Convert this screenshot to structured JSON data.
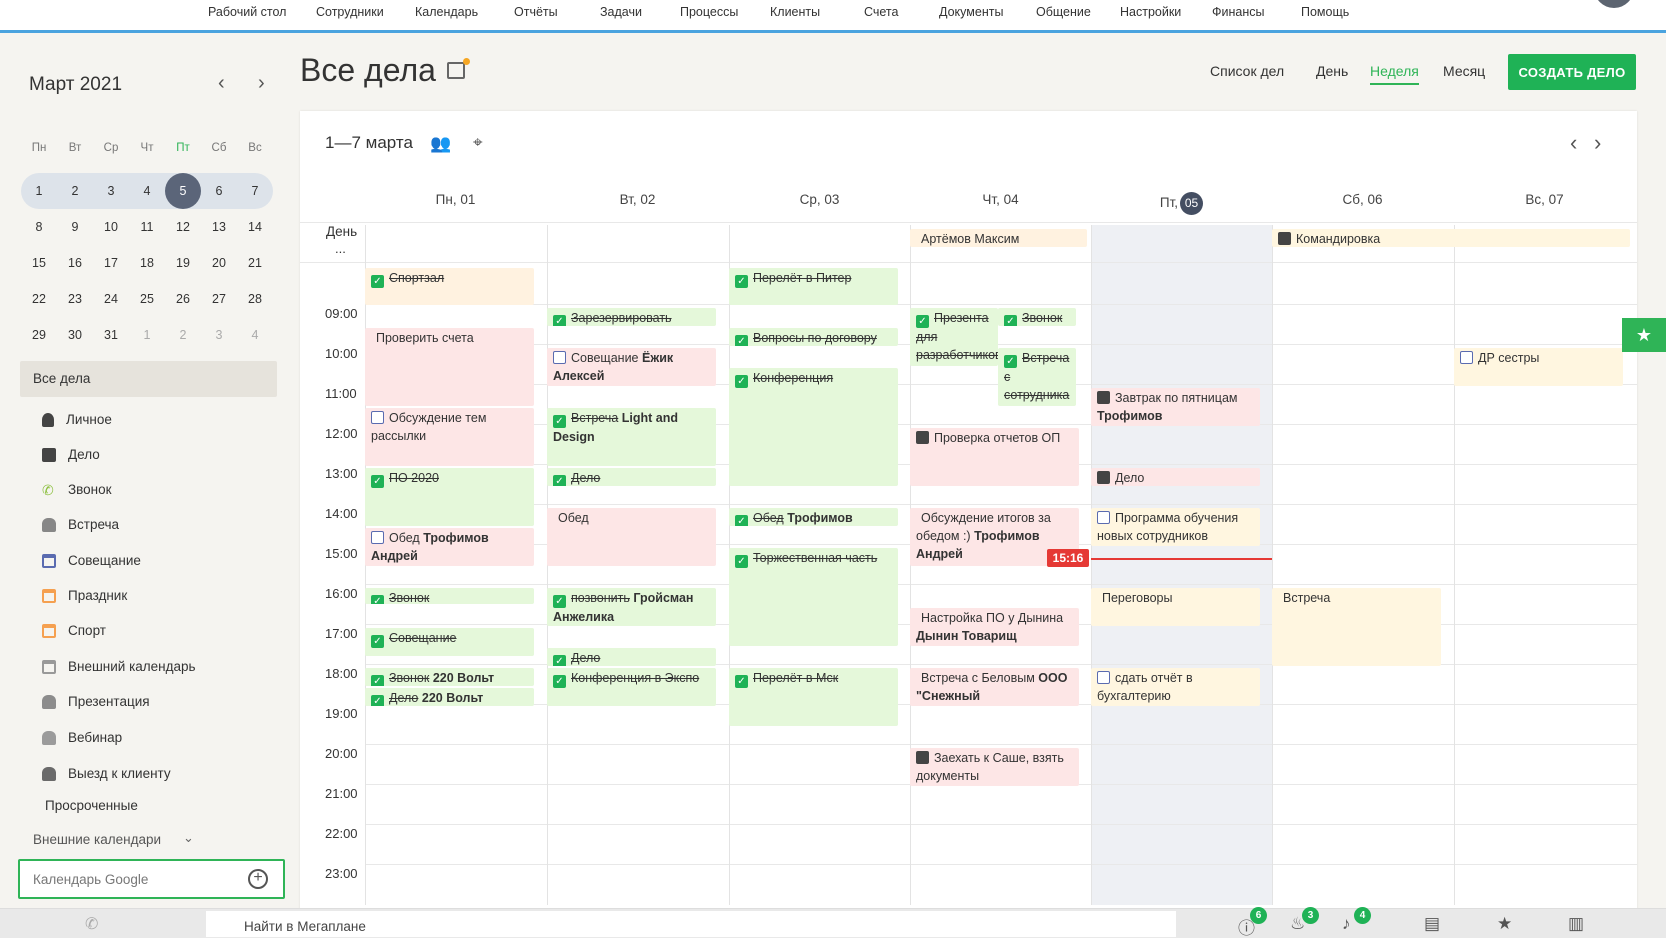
{
  "topnav": {
    "items": [
      "Рабочий стол",
      "Сотрудники",
      "Календарь",
      "Отчёты",
      "Задачи",
      "Процессы",
      "Клиенты",
      "Счета",
      "Документы",
      "Общение",
      "Настройки",
      "Финансы",
      "Помощь"
    ]
  },
  "minical": {
    "title": "Март 2021",
    "prev": "‹",
    "next": "›",
    "weekdays": [
      "Пн",
      "Вт",
      "Ср",
      "Чт",
      "Пт",
      "Сб",
      "Вс"
    ],
    "weeks": [
      [
        "1",
        "2",
        "3",
        "4",
        "5",
        "6",
        "7"
      ],
      [
        "8",
        "9",
        "10",
        "11",
        "12",
        "13",
        "14"
      ],
      [
        "15",
        "16",
        "17",
        "18",
        "19",
        "20",
        "21"
      ],
      [
        "22",
        "23",
        "24",
        "25",
        "26",
        "27",
        "28"
      ],
      [
        "29",
        "30",
        "31",
        "1",
        "2",
        "3",
        "4"
      ]
    ],
    "today": "5"
  },
  "sidebar": {
    "all": "Все дела",
    "categories": [
      {
        "label": "Личное",
        "icon": "person-icon",
        "color": "#444444"
      },
      {
        "label": "Дело",
        "icon": "briefcase-icon",
        "color": "#444444"
      },
      {
        "label": "Звонок",
        "icon": "phone-icon",
        "color": "#8cbf3f"
      },
      {
        "label": "Встреча",
        "icon": "people-icon",
        "color": "#e06c8a"
      },
      {
        "label": "Совещание",
        "icon": "calendar-icon",
        "color": "#5a6bb0"
      },
      {
        "label": "Праздник",
        "icon": "calendar-icon",
        "color": "#f5a050"
      },
      {
        "label": "Спорт",
        "icon": "calendar-icon",
        "color": "#f5a050"
      },
      {
        "label": "Внешний календарь",
        "icon": "calendar-icon",
        "color": "#999999"
      },
      {
        "label": "Презентация",
        "icon": "people-icon",
        "color": "#3caa4a"
      },
      {
        "label": "Вебинар",
        "icon": "people-icon",
        "color": "#f5884a"
      },
      {
        "label": "Выезд к клиенту",
        "icon": "people-icon",
        "color": "#8a5aa8"
      }
    ],
    "overdue": "Просроченные",
    "external": "Внешние календари",
    "google": "Календарь Google"
  },
  "header": {
    "title": "Все дела",
    "views": [
      "Список дел",
      "День",
      "Неделя",
      "Месяц"
    ],
    "active_view": "Неделя",
    "create": "СОЗДАТЬ ДЕЛО"
  },
  "calendar": {
    "range": "1—7 марта",
    "days": [
      "Пн, 01",
      "Вт, 02",
      "Ср, 03",
      "Чт, 04",
      "Пт,",
      "Сб, 06",
      "Вс, 07"
    ],
    "today_badge": "05",
    "allday_label": "День",
    "allday_more": "...",
    "hours": [
      "09:00",
      "10:00",
      "11:00",
      "12:00",
      "13:00",
      "14:00",
      "15:00",
      "16:00",
      "17:00",
      "18:00",
      "19:00",
      "20:00",
      "21:00",
      "22:00",
      "23:00"
    ],
    "now": "15:16",
    "allday_events": [
      {
        "day": 3,
        "icon": "cake",
        "text": "Артёмов Максим",
        "span": 1
      },
      {
        "day": 5,
        "icon": "bag",
        "text": "Командировка",
        "span": 2
      }
    ],
    "events": [
      {
        "day": 0,
        "cls": "o",
        "icon": "check",
        "text": "Спортзал",
        "strike": true,
        "bold": ""
      },
      {
        "day": 0,
        "cls": "p",
        "icon": "people",
        "text": "Проверить счета",
        "strike": false,
        "bold": ""
      },
      {
        "day": 0,
        "cls": "p",
        "icon": "cal",
        "text": "Обсуждение тем рассылки",
        "strike": false,
        "bold": ""
      },
      {
        "day": 0,
        "cls": "g",
        "icon": "check",
        "text": "ПО 2020",
        "strike": true,
        "bold": ""
      },
      {
        "day": 0,
        "cls": "p",
        "icon": "cal",
        "text": "Обед",
        "strike": false,
        "bold": "Трофимов Андрей"
      },
      {
        "day": 0,
        "cls": "g",
        "icon": "check",
        "text": "Звонок",
        "strike": true,
        "bold": ""
      },
      {
        "day": 0,
        "cls": "g",
        "icon": "check",
        "text": "Совещание",
        "strike": true,
        "bold": ""
      },
      {
        "day": 0,
        "cls": "g",
        "icon": "check",
        "text": "Звонок",
        "strike": true,
        "bold": "220 Вольт"
      },
      {
        "day": 0,
        "cls": "g",
        "icon": "check",
        "text": "Дело",
        "strike": true,
        "bold": "220 Вольт"
      },
      {
        "day": 1,
        "cls": "g",
        "icon": "check",
        "text": "Зарезервировать",
        "strike": true,
        "bold": ""
      },
      {
        "day": 1,
        "cls": "p",
        "icon": "cal",
        "text": "Совещание",
        "strike": false,
        "bold": "Ёжик Алексей"
      },
      {
        "day": 1,
        "cls": "g",
        "icon": "check",
        "text": "Встреча",
        "strike": true,
        "bold": "Light and Design"
      },
      {
        "day": 1,
        "cls": "g",
        "icon": "check",
        "text": "Дело",
        "strike": true,
        "bold": ""
      },
      {
        "day": 1,
        "cls": "p",
        "icon": "people",
        "text": "Обед",
        "strike": false,
        "bold": ""
      },
      {
        "day": 1,
        "cls": "g",
        "icon": "check",
        "text": "позвонить",
        "strike": true,
        "bold": "Гройсман Анжелика"
      },
      {
        "day": 1,
        "cls": "g",
        "icon": "check",
        "text": "Дело",
        "strike": true,
        "bold": ""
      },
      {
        "day": 1,
        "cls": "g",
        "icon": "check",
        "text": "Конференция в Экспо",
        "strike": true,
        "bold": ""
      },
      {
        "day": 2,
        "cls": "g",
        "icon": "check",
        "text": "Перелёт в Питер",
        "strike": true,
        "bold": ""
      },
      {
        "day": 2,
        "cls": "g",
        "icon": "check",
        "text": "Вопросы по договору",
        "strike": true,
        "bold": ""
      },
      {
        "day": 2,
        "cls": "g",
        "icon": "check",
        "text": "Конференция",
        "strike": true,
        "bold": ""
      },
      {
        "day": 2,
        "cls": "g",
        "icon": "check",
        "text": "Обед",
        "strike": true,
        "bold": "Трофимов Андрей"
      },
      {
        "day": 2,
        "cls": "g",
        "icon": "check",
        "text": "Торжественная часть",
        "strike": true,
        "bold": ""
      },
      {
        "day": 2,
        "cls": "g",
        "icon": "check",
        "text": "Перелёт в Мск",
        "strike": true,
        "bold": ""
      },
      {
        "day": 3,
        "cls": "g",
        "icon": "check",
        "text": "Презента для разработчиков",
        "strike": true,
        "bold": ""
      },
      {
        "day": 3,
        "cls": "g",
        "icon": "check",
        "text": "Звонок",
        "strike": true,
        "bold": ""
      },
      {
        "day": 3,
        "cls": "g",
        "icon": "check",
        "text": "Встреча с сотрудника",
        "strike": true,
        "bold": ""
      },
      {
        "day": 3,
        "cls": "p",
        "icon": "bag",
        "text": "Проверка отчетов ОП",
        "strike": false,
        "bold": ""
      },
      {
        "day": 3,
        "cls": "p",
        "icon": "people",
        "text": "Обсуждение итогов за обедом :)",
        "strike": false,
        "bold": "Трофимов Андрей"
      },
      {
        "day": 3,
        "cls": "p",
        "icon": "people",
        "text": "Настройка ПО у Дынина",
        "strike": false,
        "bold": "Дынин Товарищ"
      },
      {
        "day": 3,
        "cls": "p",
        "icon": "people",
        "text": "Встреча с Беловым",
        "strike": false,
        "bold": "ООО \"Снежный"
      },
      {
        "day": 3,
        "cls": "p",
        "icon": "bag",
        "text": "Заехать к Саше, взять документы",
        "strike": false,
        "bold": ""
      },
      {
        "day": 4,
        "cls": "p",
        "icon": "bag",
        "text": "Завтрак по пятницам",
        "strike": false,
        "bold": "Трофимов"
      },
      {
        "day": 4,
        "cls": "p",
        "icon": "bag",
        "text": "Дело",
        "strike": false,
        "bold": ""
      },
      {
        "day": 4,
        "cls": "y",
        "icon": "cal",
        "text": "Программа обучения новых сотрудников",
        "strike": false,
        "bold": ""
      },
      {
        "day": 4,
        "cls": "y",
        "icon": "people",
        "text": "Переговоры",
        "strike": false,
        "bold": ""
      },
      {
        "day": 4,
        "cls": "y",
        "icon": "cal",
        "text": "сдать отчёт в бухгалтерию",
        "strike": false,
        "bold": ""
      },
      {
        "day": 5,
        "cls": "y",
        "icon": "people",
        "text": "Встреча",
        "strike": false,
        "bold": ""
      },
      {
        "day": 6,
        "cls": "y",
        "icon": "cal",
        "text": "ДР сестры",
        "strike": false,
        "bold": ""
      }
    ]
  },
  "bottombar": {
    "search": "Найти в Мегаплане",
    "badges": [
      "6",
      "3",
      "4"
    ]
  }
}
